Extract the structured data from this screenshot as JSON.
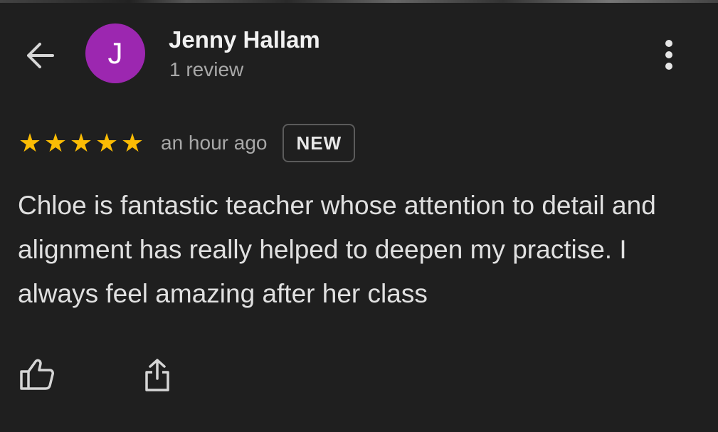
{
  "header": {
    "avatar_initial": "J",
    "reviewer_name": "Jenny Hallam",
    "review_count": "1 review"
  },
  "review": {
    "rating": 5,
    "rating_max": 5,
    "stars": [
      "★",
      "★",
      "★",
      "★",
      "★"
    ],
    "time_ago": "an hour ago",
    "badge": "NEW",
    "text": "Chloe is fantastic teacher whose attention to detail and alignment has really helped to deepen my practise. I always feel amazing after her class"
  },
  "icons": {
    "back": "arrow-left-icon",
    "more": "more-vertical-icon",
    "like": "thumbs-up-icon",
    "share": "share-icon"
  },
  "colors": {
    "background": "#1f1f1f",
    "avatar": "#9c27b0",
    "star": "#fbbc04",
    "primary_text": "#f1f1f1",
    "secondary_text": "#a8a8a8",
    "badge_border": "#5b5b5b"
  }
}
